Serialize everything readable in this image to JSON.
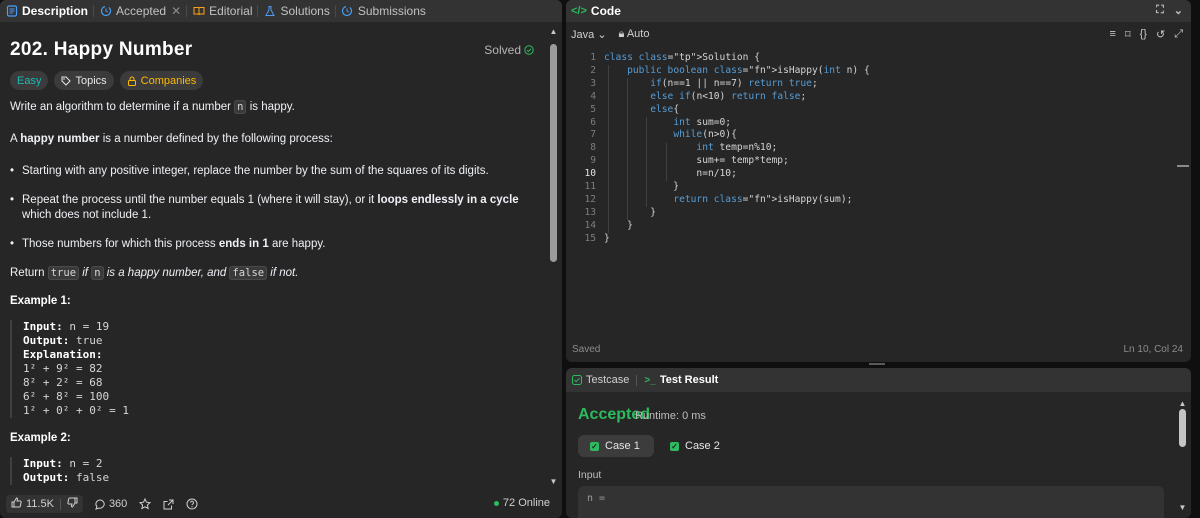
{
  "tabs": [
    {
      "label": "Description",
      "icon": "description-icon",
      "active": true
    },
    {
      "label": "Accepted",
      "icon": "history-icon",
      "closable": true
    },
    {
      "label": "Editorial",
      "icon": "book-icon"
    },
    {
      "label": "Solutions",
      "icon": "flask-icon"
    },
    {
      "label": "Submissions",
      "icon": "history-icon"
    }
  ],
  "problem": {
    "title": "202. Happy Number",
    "status": "Solved",
    "tags": [
      "Easy",
      "Topics",
      "Companies"
    ],
    "intro_1": "Write an algorithm to determine if a number",
    "intro_var": "n",
    "intro_2": "is happy.",
    "def_1": "A",
    "def_bold": "happy number",
    "def_2": "is a number defined by the following process:",
    "bullet_1": "Starting with any positive integer, replace the number by the sum of the squares of its digits.",
    "bullet_2a": "Repeat the process until the number equals 1 (where it will stay), or it",
    "bullet_2b": "loops endlessly in a cycle",
    "bullet_2c": "which does not include 1.",
    "bullet_3a": "Those numbers for which this process",
    "bullet_3b": "ends in 1",
    "bullet_3c": "are happy.",
    "return_1": "Return",
    "return_true": "true",
    "return_if": "if",
    "return_n": "n",
    "return_2": "is a happy number, and",
    "return_false": "false",
    "return_3": "if not."
  },
  "example1": {
    "title": "Example 1:",
    "input_label": "Input:",
    "input_value": " n = 19",
    "output_label": "Output:",
    "output_value": " true",
    "explanation_label": "Explanation:",
    "lines": [
      "1² + 9² = 82",
      "8² + 2² = 68",
      "6² + 8² = 100",
      "1² + 0² + 0² = 1"
    ]
  },
  "example2": {
    "title": "Example 2:",
    "input_label": "Input:",
    "input_value": " n = 2",
    "output_label": "Output:",
    "output_value": " false"
  },
  "footer": {
    "likes": "11.5K",
    "comments": "360",
    "online": "72 Online"
  },
  "code": {
    "header": "Code",
    "language": "Java",
    "mode": "Auto",
    "status": "Saved",
    "cursor": "Ln 10, Col 24",
    "current_line": 10,
    "lines": [
      "class Solution {",
      "    public boolean isHappy(int n) {",
      "        if(n==1 || n==7) return true;",
      "        else if(n<10) return false;",
      "        else{",
      "            int sum=0;",
      "            while(n>0){",
      "                int temp=n%10;",
      "                sum+= temp*temp;",
      "                n=n/10;",
      "            }",
      "            return isHappy(sum);",
      "        }",
      "    }",
      "}"
    ]
  },
  "test": {
    "tab_testcase": "Testcase",
    "tab_result": "Test Result",
    "verdict": "Accepted",
    "runtime": "Runtime: 0 ms",
    "cases": [
      "Case 1",
      "Case 2"
    ],
    "input_label": "Input",
    "input_var": "n ="
  },
  "colors": {
    "accepted": "#2cbb5d",
    "easy": "#1cbaba",
    "companies": "#ffb800",
    "background": "#262626"
  }
}
